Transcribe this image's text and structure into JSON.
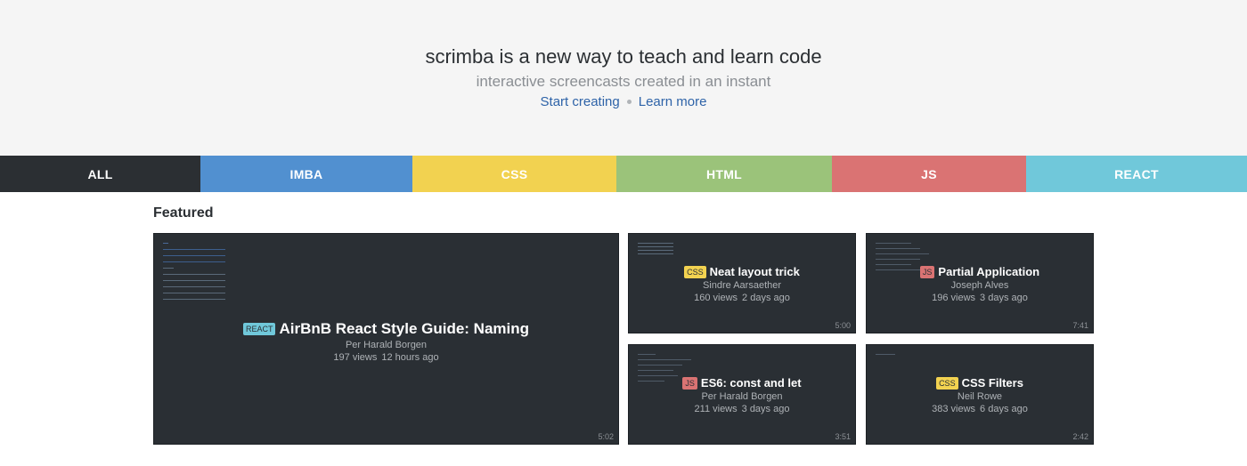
{
  "hero": {
    "title": "scrimba is a new way to teach and learn code",
    "subtitle": "interactive screencasts created in an instant",
    "start_link": "Start creating",
    "learn_link": "Learn more"
  },
  "tabs": [
    {
      "label": "ALL",
      "color": "#2b2f33"
    },
    {
      "label": "IMBA",
      "color": "#5190d0"
    },
    {
      "label": "CSS",
      "color": "#f2d250"
    },
    {
      "label": "HTML",
      "color": "#9bc37a"
    },
    {
      "label": "JS",
      "color": "#da7373"
    },
    {
      "label": "REACT",
      "color": "#70c8da"
    }
  ],
  "featured": {
    "heading": "Featured",
    "cards": [
      {
        "tag": "REACT",
        "title": "AirBnB React Style Guide: Naming",
        "author": "Per Harald Borgen",
        "views": "197 views",
        "age": "12 hours ago",
        "duration": "5:02"
      },
      {
        "tag": "CSS",
        "title": "Neat layout trick",
        "author": "Sindre Aarsaether",
        "views": "160 views",
        "age": "2 days ago",
        "duration": "5:00"
      },
      {
        "tag": "JS",
        "title": "Partial Application",
        "author": "Joseph Alves",
        "views": "196 views",
        "age": "3 days ago",
        "duration": "7:41"
      },
      {
        "tag": "JS",
        "title": "ES6: const and let",
        "author": "Per Harald Borgen",
        "views": "211 views",
        "age": "3 days ago",
        "duration": "3:51"
      },
      {
        "tag": "CSS",
        "title": "CSS Filters",
        "author": "Neil Rowe",
        "views": "383 views",
        "age": "6 days ago",
        "duration": "2:42"
      }
    ]
  }
}
